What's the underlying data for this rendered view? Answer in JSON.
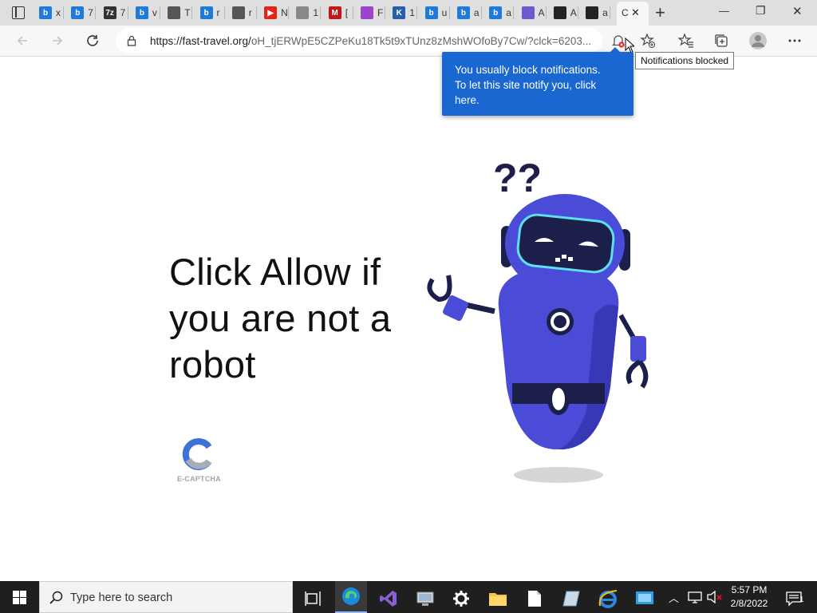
{
  "browser": {
    "tabs": [
      {
        "label": "b",
        "icon": "bing-icon",
        "text": "x",
        "color": "#1f7ad8"
      },
      {
        "label": "b",
        "icon": "bing-icon",
        "text": "7",
        "color": "#1f7ad8"
      },
      {
        "label": "7z",
        "icon": "7zip-icon",
        "text": "7",
        "color": "#333333"
      },
      {
        "label": "b",
        "icon": "bing-icon",
        "text": "v",
        "color": "#1f7ad8"
      },
      {
        "label": "",
        "icon": "document-icon",
        "text": "T",
        "color": "#555555"
      },
      {
        "label": "b",
        "icon": "bing-icon",
        "text": "r",
        "color": "#1f7ad8"
      },
      {
        "label": "",
        "icon": "speaker-icon",
        "text": "r",
        "color": "#555555"
      },
      {
        "label": "▶",
        "icon": "youtube-icon",
        "text": "N",
        "color": "#e62117"
      },
      {
        "label": "",
        "icon": "image-icon",
        "text": "1",
        "color": "#888888"
      },
      {
        "label": "M",
        "icon": "mcafee-icon",
        "text": "[",
        "color": "#c01818"
      },
      {
        "label": "",
        "icon": "colorful-icon",
        "text": "F",
        "color": "#9b43c9"
      },
      {
        "label": "K",
        "icon": "k-icon",
        "text": "1",
        "color": "#2a5ea8"
      },
      {
        "label": "b",
        "icon": "bing-icon",
        "text": "u",
        "color": "#1f7ad8"
      },
      {
        "label": "b",
        "icon": "bing-icon",
        "text": "a",
        "color": "#1f7ad8"
      },
      {
        "label": "b",
        "icon": "bing-icon",
        "text": "a",
        "color": "#1f7ad8"
      },
      {
        "label": "",
        "icon": "yahoo-icon",
        "text": "A",
        "color": "#6a5acd"
      },
      {
        "label": "",
        "icon": "mountain-icon",
        "text": "A",
        "color": "#222222"
      },
      {
        "label": "",
        "icon": "mountain-icon",
        "text": "a",
        "color": "#222222"
      }
    ],
    "active_tab": {
      "text": "C",
      "close": "✕"
    },
    "new_tab": "+",
    "window_controls": {
      "minimize": "—",
      "maximize": "❐",
      "close": "✕"
    },
    "url": {
      "main": "https://fast-travel.org/",
      "rest": "oH_tjERWpE5CZPeKu18Tk5t9xTUnz8zMshWOfoBy7Cw/?clck=6203..."
    }
  },
  "notification_popup": {
    "line1": "You usually block notifications.",
    "line2": "To let this site notify you, click",
    "line3": "here."
  },
  "tooltip": "Notifications blocked",
  "page": {
    "headline_1": "Click Allow if",
    "headline_2": "you are not a",
    "headline_3": "robot",
    "captcha_label": "E-CAPTCHA"
  },
  "taskbar": {
    "search_placeholder": "Type here to search",
    "time": "5:57 PM",
    "date": "2/8/2022",
    "notification_count": "1"
  }
}
